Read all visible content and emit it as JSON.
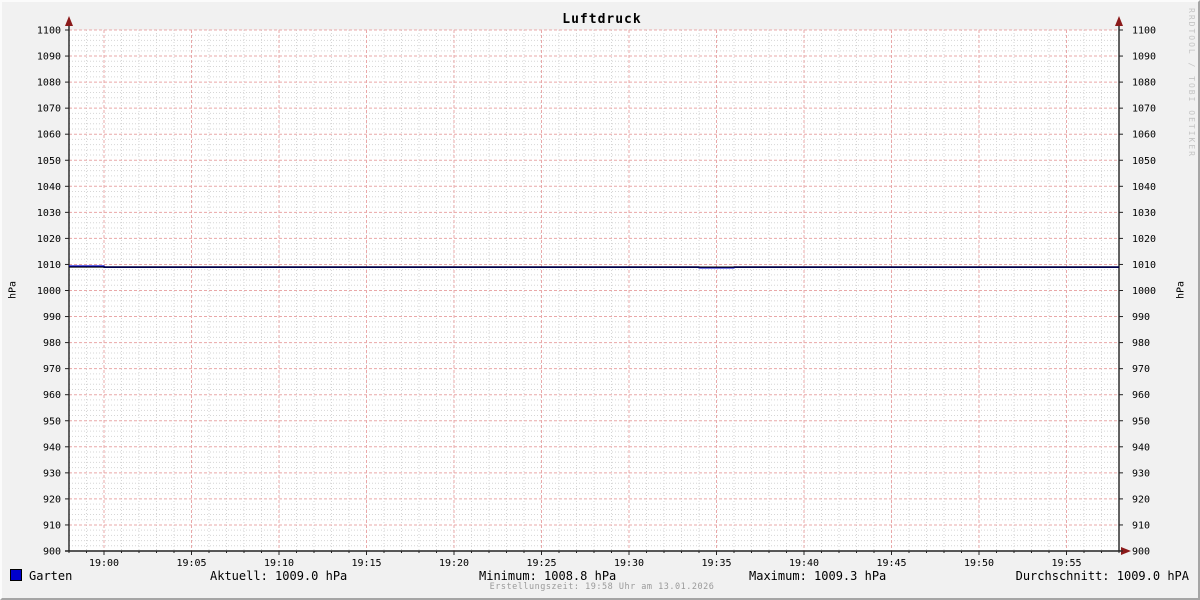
{
  "header": {
    "title": "Luftdruck"
  },
  "watermark": "RRDTOOL / TOBI OETIKER",
  "axes": {
    "y_unit": "hPa",
    "y_min": 900,
    "y_max": 1100,
    "y_major_step": 10,
    "y_minor_step": 2,
    "x_total_minutes": 60,
    "x_minor_step_minutes": 1,
    "x_ticks": [
      {
        "minute": 2,
        "label": "19:00"
      },
      {
        "minute": 7,
        "label": "19:05"
      },
      {
        "minute": 12,
        "label": "19:10"
      },
      {
        "minute": 17,
        "label": "19:15"
      },
      {
        "minute": 22,
        "label": "19:20"
      },
      {
        "minute": 27,
        "label": "19:25"
      },
      {
        "minute": 32,
        "label": "19:30"
      },
      {
        "minute": 37,
        "label": "19:35"
      },
      {
        "minute": 42,
        "label": "19:40"
      },
      {
        "minute": 47,
        "label": "19:45"
      },
      {
        "minute": 52,
        "label": "19:50"
      },
      {
        "minute": 57,
        "label": "19:55"
      }
    ]
  },
  "chart_data": {
    "type": "line",
    "title": "Luftdruck",
    "ylabel": "hPa",
    "ylim": [
      900,
      1100
    ],
    "y_tick_step": 10,
    "grid": true,
    "legend_position": "bottom",
    "x_axis": "time of day, 1-minute resolution, window ~18:58 to 19:58",
    "series": [
      {
        "name": "Garten",
        "color": "#0000cc",
        "points": [
          [
            0,
            1009.3
          ],
          [
            2,
            1009.3
          ],
          [
            2,
            1009.0
          ],
          [
            36,
            1009.0
          ],
          [
            36,
            1008.8
          ],
          [
            38,
            1008.8
          ],
          [
            38,
            1009.0
          ],
          [
            60,
            1009.0
          ]
        ],
        "stats": {
          "aktuell": 1009.0,
          "minimum": 1008.8,
          "maximum": 1009.3,
          "durchschnitt": 1009.0
        }
      }
    ],
    "hrule": {
      "value": 1009.0,
      "color": "#000000",
      "meaning": "Durchschnitt"
    }
  },
  "legend": {
    "series_label": "Garten",
    "stats": [
      {
        "name": "aktuell",
        "text": "Aktuell: 1009.0 hPa"
      },
      {
        "name": "minimum",
        "text": "Minimum: 1008.8 hPa"
      },
      {
        "name": "maximum",
        "text": "Maximum: 1009.3 hPa"
      },
      {
        "name": "durchschnitt",
        "text": "Durchschnitt: 1009.0 hPA"
      }
    ]
  },
  "footer": {
    "text": "Erstellungszeit: 19:58 Uhr am 13.01.2026"
  },
  "colors": {
    "background": "#f1f1f1",
    "plot_background": "#ffffff",
    "grid_minor": "#d6d6d6",
    "grid_major": "#e9a8a8",
    "axis": "#222222",
    "arrow": "#8b1a1a",
    "series": "#0000cc",
    "average_line": "#000000",
    "watermark": "#c4c4c4",
    "footer_text": "#9a9a9a"
  }
}
